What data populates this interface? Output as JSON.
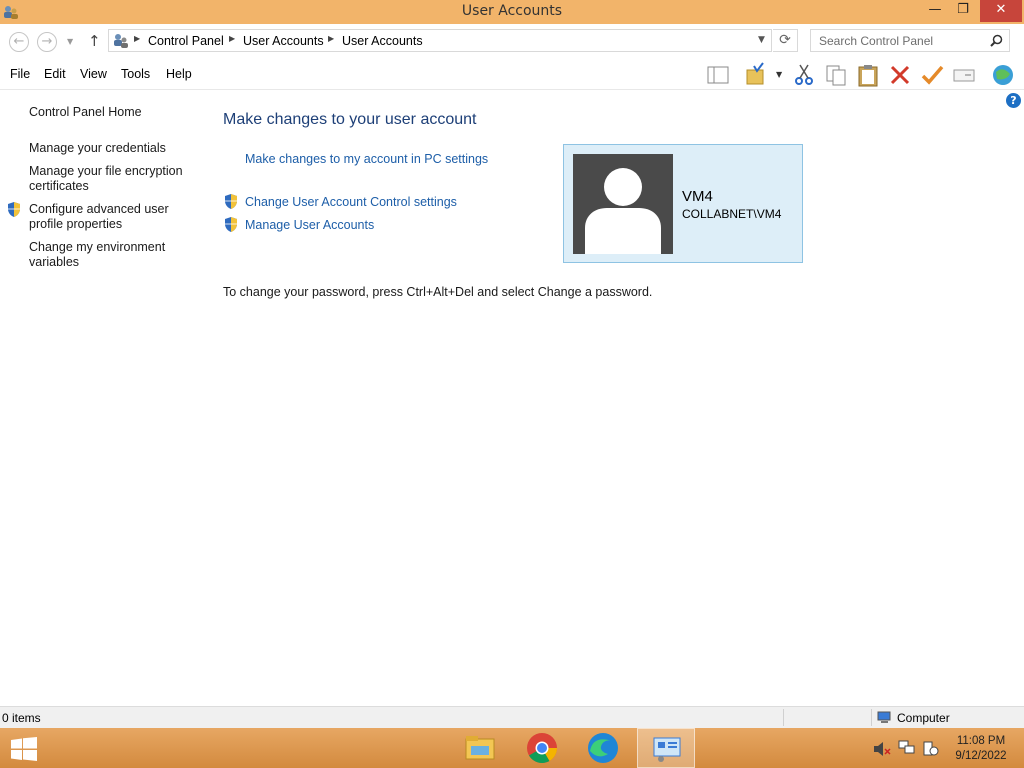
{
  "window": {
    "title": "User Accounts",
    "minimize": "—",
    "maximize": "❐",
    "close": "✕"
  },
  "nav": {
    "back": "←",
    "forward": "→",
    "up": "↑",
    "breadcrumbs": [
      "Control Panel",
      "User Accounts",
      "User Accounts"
    ],
    "search_placeholder": "Search Control Panel"
  },
  "menu": [
    "File",
    "Edit",
    "View",
    "Tools",
    "Help"
  ],
  "left_pane": {
    "home": "Control Panel Home",
    "links": [
      {
        "text": "Manage your credentials"
      },
      {
        "text": "Manage your file encryption certificates"
      },
      {
        "text": "Configure advanced user profile properties",
        "shield": true
      },
      {
        "text": "Change my environment variables"
      }
    ]
  },
  "main": {
    "heading": "Make changes to your user account",
    "pc_settings_link": "Make changes to my account in PC settings",
    "uac_link": "Change User Account Control settings",
    "manage_link": "Manage User Accounts",
    "password_note": "To change your password, press Ctrl+Alt+Del and select Change a password."
  },
  "account": {
    "name": "VM4",
    "domain_user": "COLLABNET\\VM4"
  },
  "status": {
    "items": "0 items",
    "location": "Computer"
  },
  "taskbar": {
    "time": "11:08 PM",
    "date": "9/12/2022"
  },
  "colors": {
    "titlebar": "#f2b46a",
    "close": "#c7453b",
    "link": "#1d5ea8",
    "heading": "#1d3f77",
    "account_tile": "#ddeef8"
  }
}
